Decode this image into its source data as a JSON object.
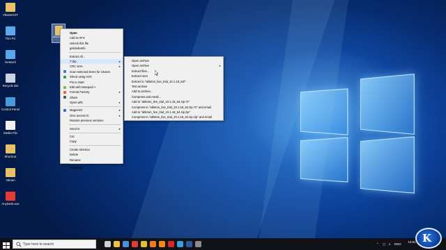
{
  "desktop": {
    "icons": [
      {
        "label": "VikramGST",
        "icon": "folder-icon",
        "color": "#e8c068"
      },
      {
        "label": "This PC",
        "icon": "computer-icon",
        "color": "#5aa8e8"
      },
      {
        "label": "Network",
        "icon": "network-icon",
        "color": "#5aa8e8"
      },
      {
        "label": "Recycle Bin",
        "icon": "recycle-bin-icon",
        "color": "#c8d4e0"
      },
      {
        "label": "Control Panel",
        "icon": "control-panel-icon",
        "color": "#4a9ad8"
      },
      {
        "label": "Media File",
        "icon": "media-file-icon",
        "color": "#f0f0f0"
      },
      {
        "label": "ShortCut",
        "icon": "shortcut-icon",
        "color": "#e8c068"
      },
      {
        "label": "Vikram",
        "icon": "folder-icon",
        "color": "#e8c068"
      },
      {
        "label": "AnyDesk.exe",
        "icon": "anydesk-icon",
        "color": "#e23a35"
      }
    ],
    "selected_file_label": "ableton_live_trial_10.1.18_64.zip"
  },
  "context_menu": {
    "items": [
      {
        "label": "Open",
        "bold": true
      },
      {
        "label": "Add to HFS"
      },
      {
        "label": "Unlock this file"
      },
      {
        "label": "gHidedaInfo"
      },
      {
        "sep": true
      },
      {
        "label": "Extract All..."
      },
      {
        "label": "7-Zip",
        "submenu": true,
        "highlight": true
      },
      {
        "label": "CRC SHA",
        "submenu": true
      },
      {
        "label": "Scan selected items for viruses",
        "icon": "#2f7de1"
      },
      {
        "label": "Shred using AVG",
        "icon": "#3a9a4a"
      },
      {
        "label": "Pin to Start"
      },
      {
        "label": "Edit with Notepad++",
        "icon": "#7ab648"
      },
      {
        "label": "Format Factory",
        "submenu": true,
        "icon": "#e8632b"
      },
      {
        "label": "Share",
        "icon": "#555555"
      },
      {
        "label": "Open with",
        "submenu": true
      },
      {
        "sep": true
      },
      {
        "label": "MagicISO",
        "submenu": true,
        "icon": "#2b6fd1"
      },
      {
        "label": "Give access to",
        "submenu": true
      },
      {
        "label": "Restore previous versions"
      },
      {
        "sep": true
      },
      {
        "label": "Send to",
        "submenu": true
      },
      {
        "sep": true
      },
      {
        "label": "Cut"
      },
      {
        "label": "Copy"
      },
      {
        "sep": true
      },
      {
        "label": "Create shortcut"
      },
      {
        "label": "Delete"
      },
      {
        "label": "Rename"
      },
      {
        "sep": true
      },
      {
        "label": "Properties"
      }
    ]
  },
  "submenu_7zip": {
    "items": [
      {
        "label": "Open archive"
      },
      {
        "label": "Open archive",
        "submenu": true
      },
      {
        "label": "Extract files..."
      },
      {
        "label": "Extract Here"
      },
      {
        "label": "Extract to \"ableton_live_trial_10.1.18_64\\\""
      },
      {
        "label": "Test archive"
      },
      {
        "label": "Add to archive..."
      },
      {
        "label": "Compress and email..."
      },
      {
        "label": "Add to \"ableton_live_trial_10.1.18_64.zip.7z\""
      },
      {
        "label": "Compress to \"ableton_live_trial_10.1.18_64.zip.7z\" and email"
      },
      {
        "label": "Add to \"ableton_live_trial_10.1.18_64.zip.zip\""
      },
      {
        "label": "Compress to \"ableton_live_trial_10.1.18_64.zip.zip\" and email"
      }
    ]
  },
  "taskbar": {
    "search_placeholder": "Type here to search",
    "pinned": [
      {
        "icon": "task-view-icon",
        "color": "#d0d0d0"
      },
      {
        "icon": "file-explorer-icon",
        "color": "#f0c040"
      },
      {
        "icon": "store-icon",
        "color": "#4a8fe0"
      },
      {
        "icon": "anydesk-icon",
        "color": "#e23a35"
      },
      {
        "icon": "chrome-icon",
        "color": "#e0c030"
      },
      {
        "icon": "firefox-icon",
        "color": "#f07a20"
      },
      {
        "icon": "vlc-icon",
        "color": "#f08a10"
      },
      {
        "icon": "opera-icon",
        "color": "#d8262b"
      },
      {
        "icon": "edge-icon",
        "color": "#3aa0e0"
      },
      {
        "icon": "photoshop-icon",
        "color": "#2a5a9a"
      },
      {
        "icon": "app-icon",
        "color": "#8a8a8a"
      }
    ],
    "language": "ENG",
    "time": "10:51",
    "date": "28-11-2019"
  },
  "watermark": {
    "letter": "K"
  }
}
